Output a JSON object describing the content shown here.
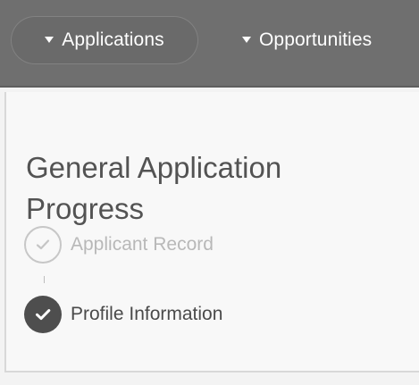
{
  "nav": {
    "tabs": [
      {
        "label": "Applications",
        "active": true
      },
      {
        "label": "Opportunities",
        "active": false
      }
    ]
  },
  "card": {
    "title": "General Application Progress"
  },
  "steps": [
    {
      "label": "Applicant Record",
      "state": "pending",
      "icon": "check-circle-outline-icon"
    },
    {
      "label": "Profile Information",
      "state": "complete",
      "icon": "check-circle-filled-icon"
    }
  ],
  "colors": {
    "topbar": "#6f6f6f",
    "active_tab": "#6a6a6a",
    "title": "#535353",
    "pending_step": "#b8b8b8",
    "complete_step": "#4e4e4e"
  }
}
